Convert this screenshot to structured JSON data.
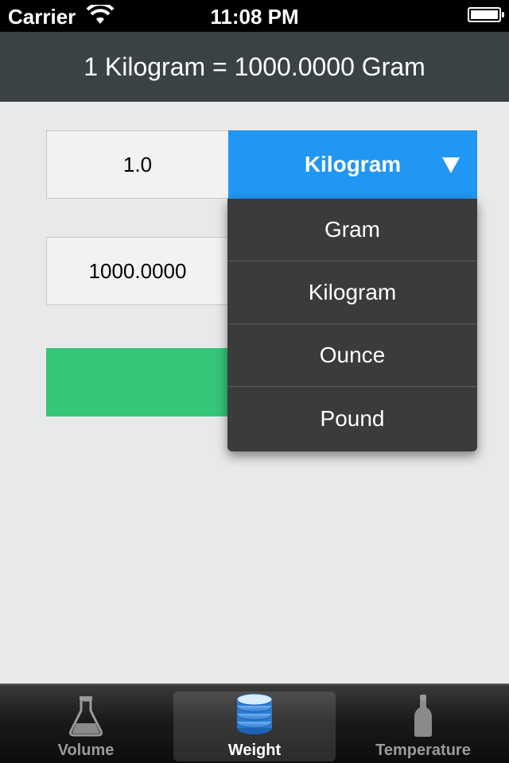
{
  "status_bar": {
    "carrier": "Carrier",
    "time": "11:08 PM",
    "icons": [
      "wifi-icon",
      "battery-icon"
    ]
  },
  "header": {
    "title": "1 Kilogram = 1000.0000 Gram"
  },
  "converter": {
    "input_value": "1.0",
    "selected_unit": "Kilogram",
    "output_value": "1000.0000",
    "accent_color": "#2196f3",
    "button_color": "#35c67a"
  },
  "dropdown": {
    "options": [
      "Gram",
      "Kilogram",
      "Ounce",
      "Pound"
    ]
  },
  "tab_bar": {
    "active": "Weight",
    "tabs": [
      {
        "label": "Volume",
        "icon": "flask-icon"
      },
      {
        "label": "Weight",
        "icon": "database-stack-icon"
      },
      {
        "label": "Temperature",
        "icon": "bottle-icon"
      }
    ]
  }
}
